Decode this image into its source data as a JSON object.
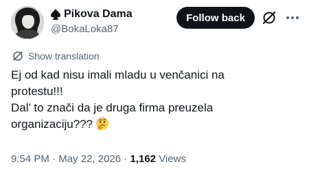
{
  "author": {
    "display_name": "Pikova Dama",
    "handle": "@BokaLoka87",
    "avatar_icon": "portrait-avatar",
    "name_emoji_icon": "spade-icon"
  },
  "actions": {
    "follow_label": "Follow back",
    "grok_icon": "grok-icon",
    "more_icon": "more-horizontal-icon"
  },
  "translation": {
    "label": "Show translation",
    "icon": "globe-slash-icon"
  },
  "tweet": {
    "lines": [
      "Ej od kad nisu imali mladu u venčanici na",
      "protestu!!!",
      "Dal’ to znači da je druga firma preuzela",
      "organizaciju???"
    ],
    "trailing_emoji": "thinking-face-icon"
  },
  "meta": {
    "time": "9:54 PM",
    "separator": "·",
    "date": "May 22, 2026",
    "views_count": "1,162",
    "views_label": "Views"
  },
  "colors": {
    "text": "#0f1419",
    "secondary": "#536471",
    "button_bg": "#0f1419",
    "button_text": "#ffffff",
    "background": "#ffffff"
  }
}
